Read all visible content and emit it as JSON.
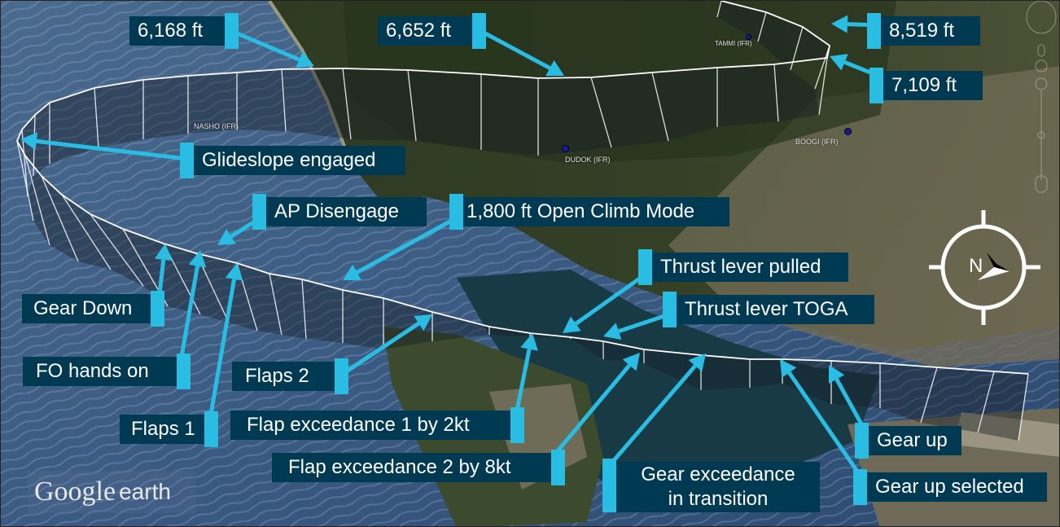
{
  "map": {
    "provider_logo": {
      "primary": "Google",
      "secondary": "earth"
    },
    "compass_label": "N",
    "waypoints": [
      {
        "name": "NASHO (IFR)"
      },
      {
        "name": "DUDOK (IFR)"
      },
      {
        "name": "TAMMI (IFR)"
      },
      {
        "name": "BOOGI (IFR)"
      }
    ]
  },
  "colors": {
    "label_bg": "#003a52",
    "accent": "#29bde4",
    "label_text": "#ffffff",
    "track": "#ffffff"
  },
  "altitude_labels": [
    {
      "text": "6,168 ft"
    },
    {
      "text": "6,652 ft"
    },
    {
      "text": "8,519 ft"
    },
    {
      "text": "7,109 ft"
    }
  ],
  "event_labels": [
    {
      "text": "Glideslope engaged"
    },
    {
      "text": "AP Disengage"
    },
    {
      "text": "1,800 ft Open Climb Mode"
    },
    {
      "text": "Thrust lever pulled"
    },
    {
      "text": "Thrust lever TOGA"
    },
    {
      "text": "Gear Down"
    },
    {
      "text": "FO hands on"
    },
    {
      "text": "Flaps 2"
    },
    {
      "text": "Flaps 1"
    },
    {
      "text": "Flap exceedance 1 by 2kt"
    },
    {
      "text": "Flap exceedance 2 by 8kt"
    },
    {
      "text": "Gear exceedance",
      "text2": "in transition"
    },
    {
      "text": "Gear up"
    },
    {
      "text": "Gear up selected"
    }
  ]
}
